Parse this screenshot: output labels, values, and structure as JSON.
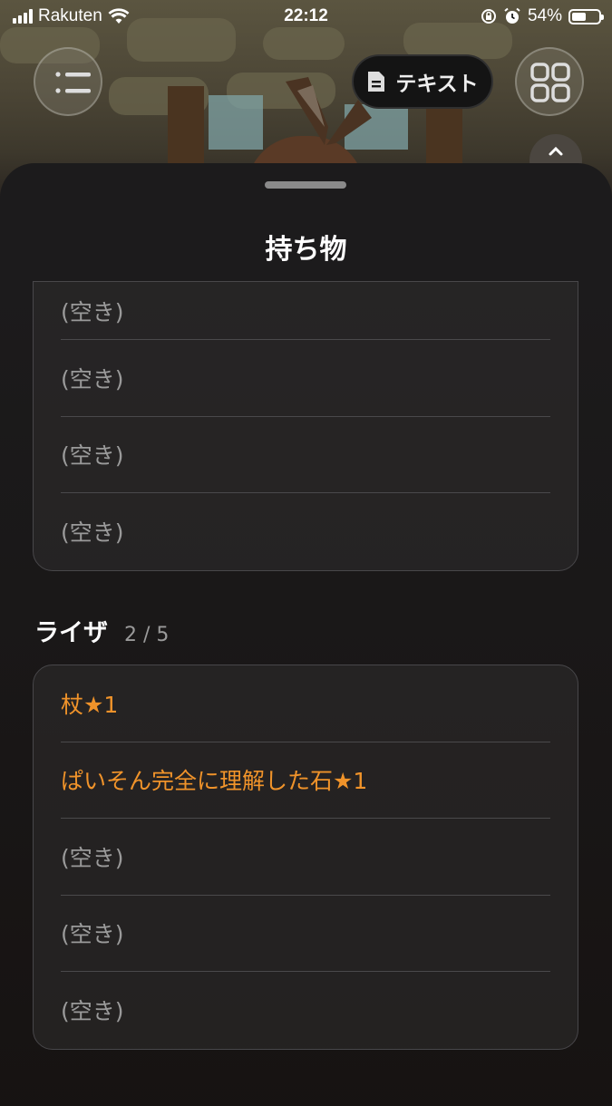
{
  "status_bar": {
    "carrier": "Rakuten",
    "time": "22:12",
    "battery_percent": "54%",
    "battery_level": 0.54
  },
  "game_ui": {
    "text_button_label": "テキスト",
    "menu_icon": "list-icon",
    "grid_icon": "grid-icon",
    "collapse_icon": "chevron-up-icon"
  },
  "sheet": {
    "title": "持ち物",
    "upper_slots": [
      "(空き)",
      "(空き)",
      "(空き)",
      "(空き)"
    ],
    "section": {
      "name": "ライザ",
      "count": "2 / 5",
      "slots": [
        "杖★1",
        "ぱいそん完全に理解した石★1",
        "(空き)",
        "(空き)",
        "(空き)"
      ]
    }
  },
  "colors": {
    "item_text": "#f0932a",
    "empty_text": "#9a9a9a",
    "sheet_bg": "#1c1b1c"
  }
}
